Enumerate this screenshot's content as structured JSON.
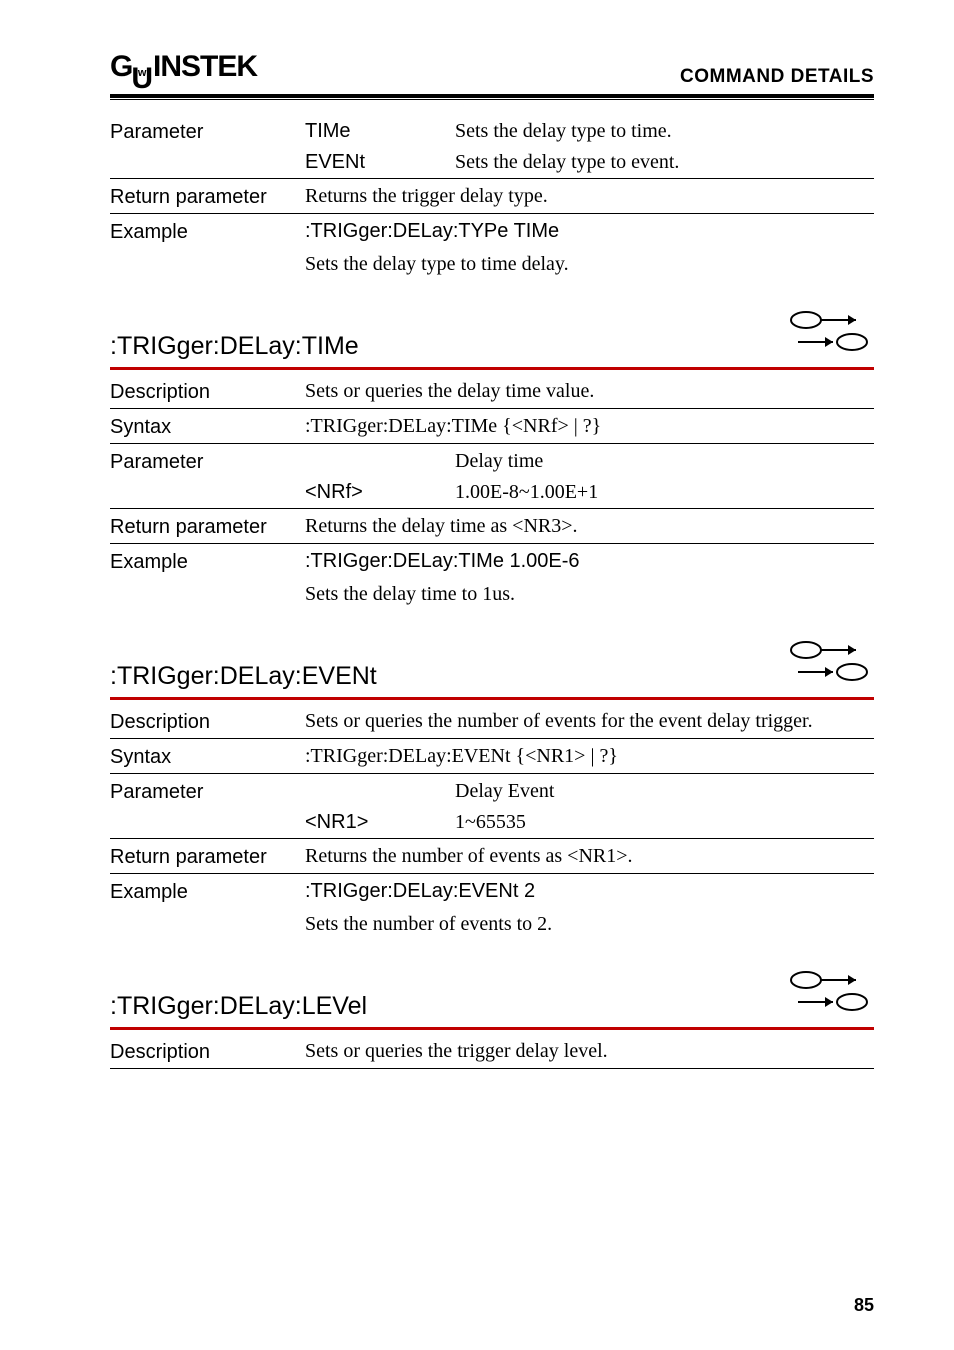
{
  "header": {
    "logo_text": "GWINSTEK",
    "title": "COMMAND DETAILS"
  },
  "block1": {
    "parameter_label": "Parameter",
    "param_rows": [
      {
        "name": "TIMe",
        "desc": "Sets the delay type to time."
      },
      {
        "name": "EVENt",
        "desc": "Sets the delay type to event."
      }
    ],
    "return_param_label": "Return parameter",
    "return_param_text": "Returns the trigger delay type.",
    "example_label": "Example",
    "example_cmd": ":TRIGger:DELay:TYPe TIMe",
    "example_desc": "Sets the delay type to time delay."
  },
  "section_time": {
    "title": ":TRIGger:DELay:TIMe",
    "description_label": "Description",
    "description_text": "Sets or queries the delay time value.",
    "syntax_label": "Syntax",
    "syntax_text": ":TRIGger:DELay:TIMe {<NRf> | ?}",
    "parameter_label": "Parameter",
    "param_desc": "Delay time",
    "param_name": "<NRf>",
    "param_range": "1.00E-8~1.00E+1",
    "return_param_label": "Return parameter",
    "return_param_text": "Returns the delay time as <NR3>.",
    "example_label": "Example",
    "example_cmd": ":TRIGger:DELay:TIMe 1.00E-6",
    "example_desc": "Sets the delay time to 1us."
  },
  "section_event": {
    "title": ":TRIGger:DELay:EVENt",
    "description_label": "Description",
    "description_text": "Sets or queries the number of events for the event delay trigger.",
    "syntax_label": "Syntax",
    "syntax_text": ":TRIGger:DELay:EVENt {<NR1> | ?}",
    "parameter_label": "Parameter",
    "param_desc": "Delay Event",
    "param_name": "<NR1>",
    "param_range": "1~65535",
    "return_param_label": "Return parameter",
    "return_param_text": "Returns the number of events as <NR1>.",
    "example_label": "Example",
    "example_cmd": ":TRIGger:DELay:EVENt 2",
    "example_desc": "Sets the number of events to 2."
  },
  "section_level": {
    "title": ":TRIGger:DELay:LEVel",
    "description_label": "Description",
    "description_text": "Sets or queries the trigger delay level."
  },
  "page_number": "85"
}
